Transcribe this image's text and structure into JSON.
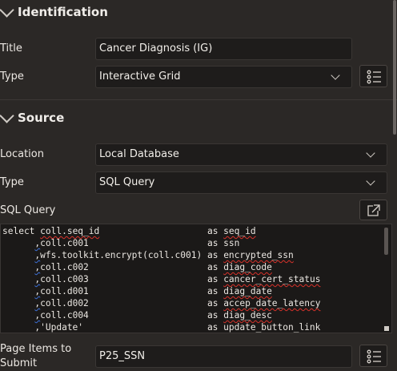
{
  "identification": {
    "header": "Identification",
    "title_label": "Title",
    "title_value": "Cancer Diagnosis (IG)",
    "type_label": "Type",
    "type_value": "Interactive Grid"
  },
  "source": {
    "header": "Source",
    "location_label": "Location",
    "location_value": "Local Database",
    "type_label": "Type",
    "type_value": "SQL Query",
    "sql_label": "SQL Query",
    "sql_lines": [
      "select coll.seq_id                    as seq_id",
      "      ,coll.c001                      as ssn",
      "      ,wfs.toolkit.encrypt(coll.c001) as encrypted_ssn",
      "      ,coll.c002                      as diag_code",
      "      ,coll.c003                      as cancer_cert_status",
      "      ,coll.d001                      as diag_date",
      "      ,coll.d002                      as accep_date_latency",
      "      ,coll.c004                      as diag_desc",
      "      ,'Update'                       as update_button_link"
    ],
    "page_items_label_1": "Page Items to",
    "page_items_label_2": "Submit",
    "page_items_value": "P25_SSN"
  }
}
